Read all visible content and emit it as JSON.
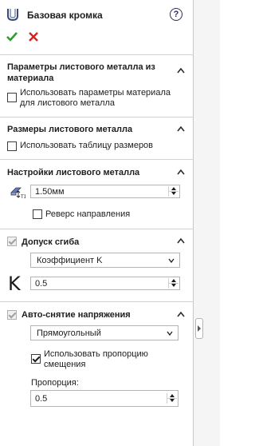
{
  "header": {
    "title": "Базовая кромка",
    "help_label": "?"
  },
  "sections": {
    "material": {
      "title": "Параметры листового металла из материала",
      "checkbox_label": "Использовать параметры материала для листового металла"
    },
    "sizes": {
      "title": "Размеры листового металла",
      "checkbox_label": "Использовать таблицу размеров"
    },
    "settings": {
      "title": "Настройки листового металла",
      "thickness_value": "1.50мм",
      "reverse_label": "Реверс направления"
    },
    "bend": {
      "title": "Допуск сгиба",
      "type_value": "Коэффициент K",
      "k_symbol": "K",
      "k_value": "0.5"
    },
    "relief": {
      "title": "Авто-снятие напряжения",
      "type_value": "Прямоугольный",
      "ratio_checkbox_label": "Использовать пропорцию смещения",
      "ratio_label": "Пропорция:",
      "ratio_value": "0.5"
    }
  },
  "colors": {
    "ok": "#2e9e2e",
    "cancel": "#d22222"
  }
}
